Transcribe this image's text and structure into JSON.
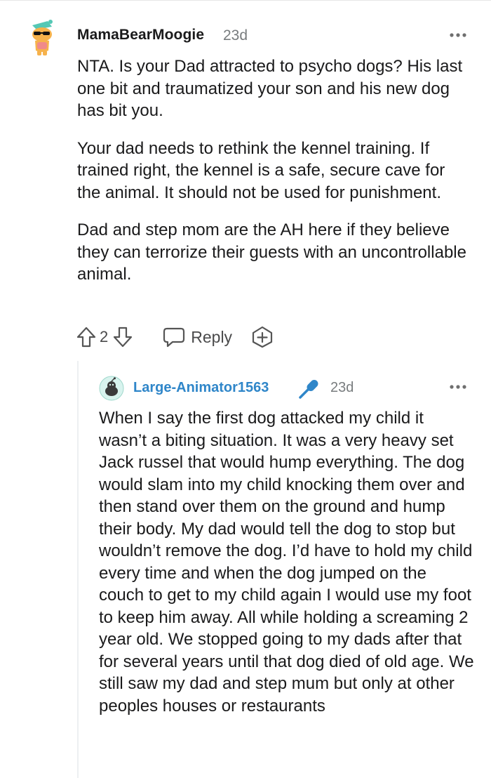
{
  "comment": {
    "username": "MamaBearMoogie",
    "time": "23d",
    "avatar_icon": "snoo-avatar-sunglasses-icon",
    "paragraphs": [
      "NTA. Is your Dad attracted to psycho dogs? His last one bit and traumatized your son and his new dog has bit you.",
      "Your dad needs to rethink the kennel training. If trained right, the kennel is a safe, secure cave for the animal. It should not be used for punishment.",
      "Dad and step mom are the AH here if they believe they can terrorize their guests with an uncontrollable animal."
    ],
    "score": "2",
    "reply_label": "Reply"
  },
  "reply": {
    "username": "Large-Animator1563",
    "badge_icon": "microphone-icon",
    "time": "23d",
    "avatar_icon": "snoo-avatar-default-icon",
    "body": "When I say the first dog attacked my child it wasn’t a biting situation. It was a very heavy set Jack russel that would hump everything. The dog would slam into my child knocking them over and then stand over them on the ground and hump their body. My dad would tell the dog to stop but wouldn’t remove the dog. I’d have to hold my child every time and when the dog jumped on the couch to get to my child again I would use my foot to keep him away. All while holding a screaming 2 year old. We stopped going to my dads after that for several years until that dog died of old age. We still saw my dad and step mum but only at other peoples houses or restaurants"
  },
  "colors": {
    "username_link": "#2f86c9",
    "meta_gray": "#787c7e",
    "text": "#1a1a1b"
  }
}
